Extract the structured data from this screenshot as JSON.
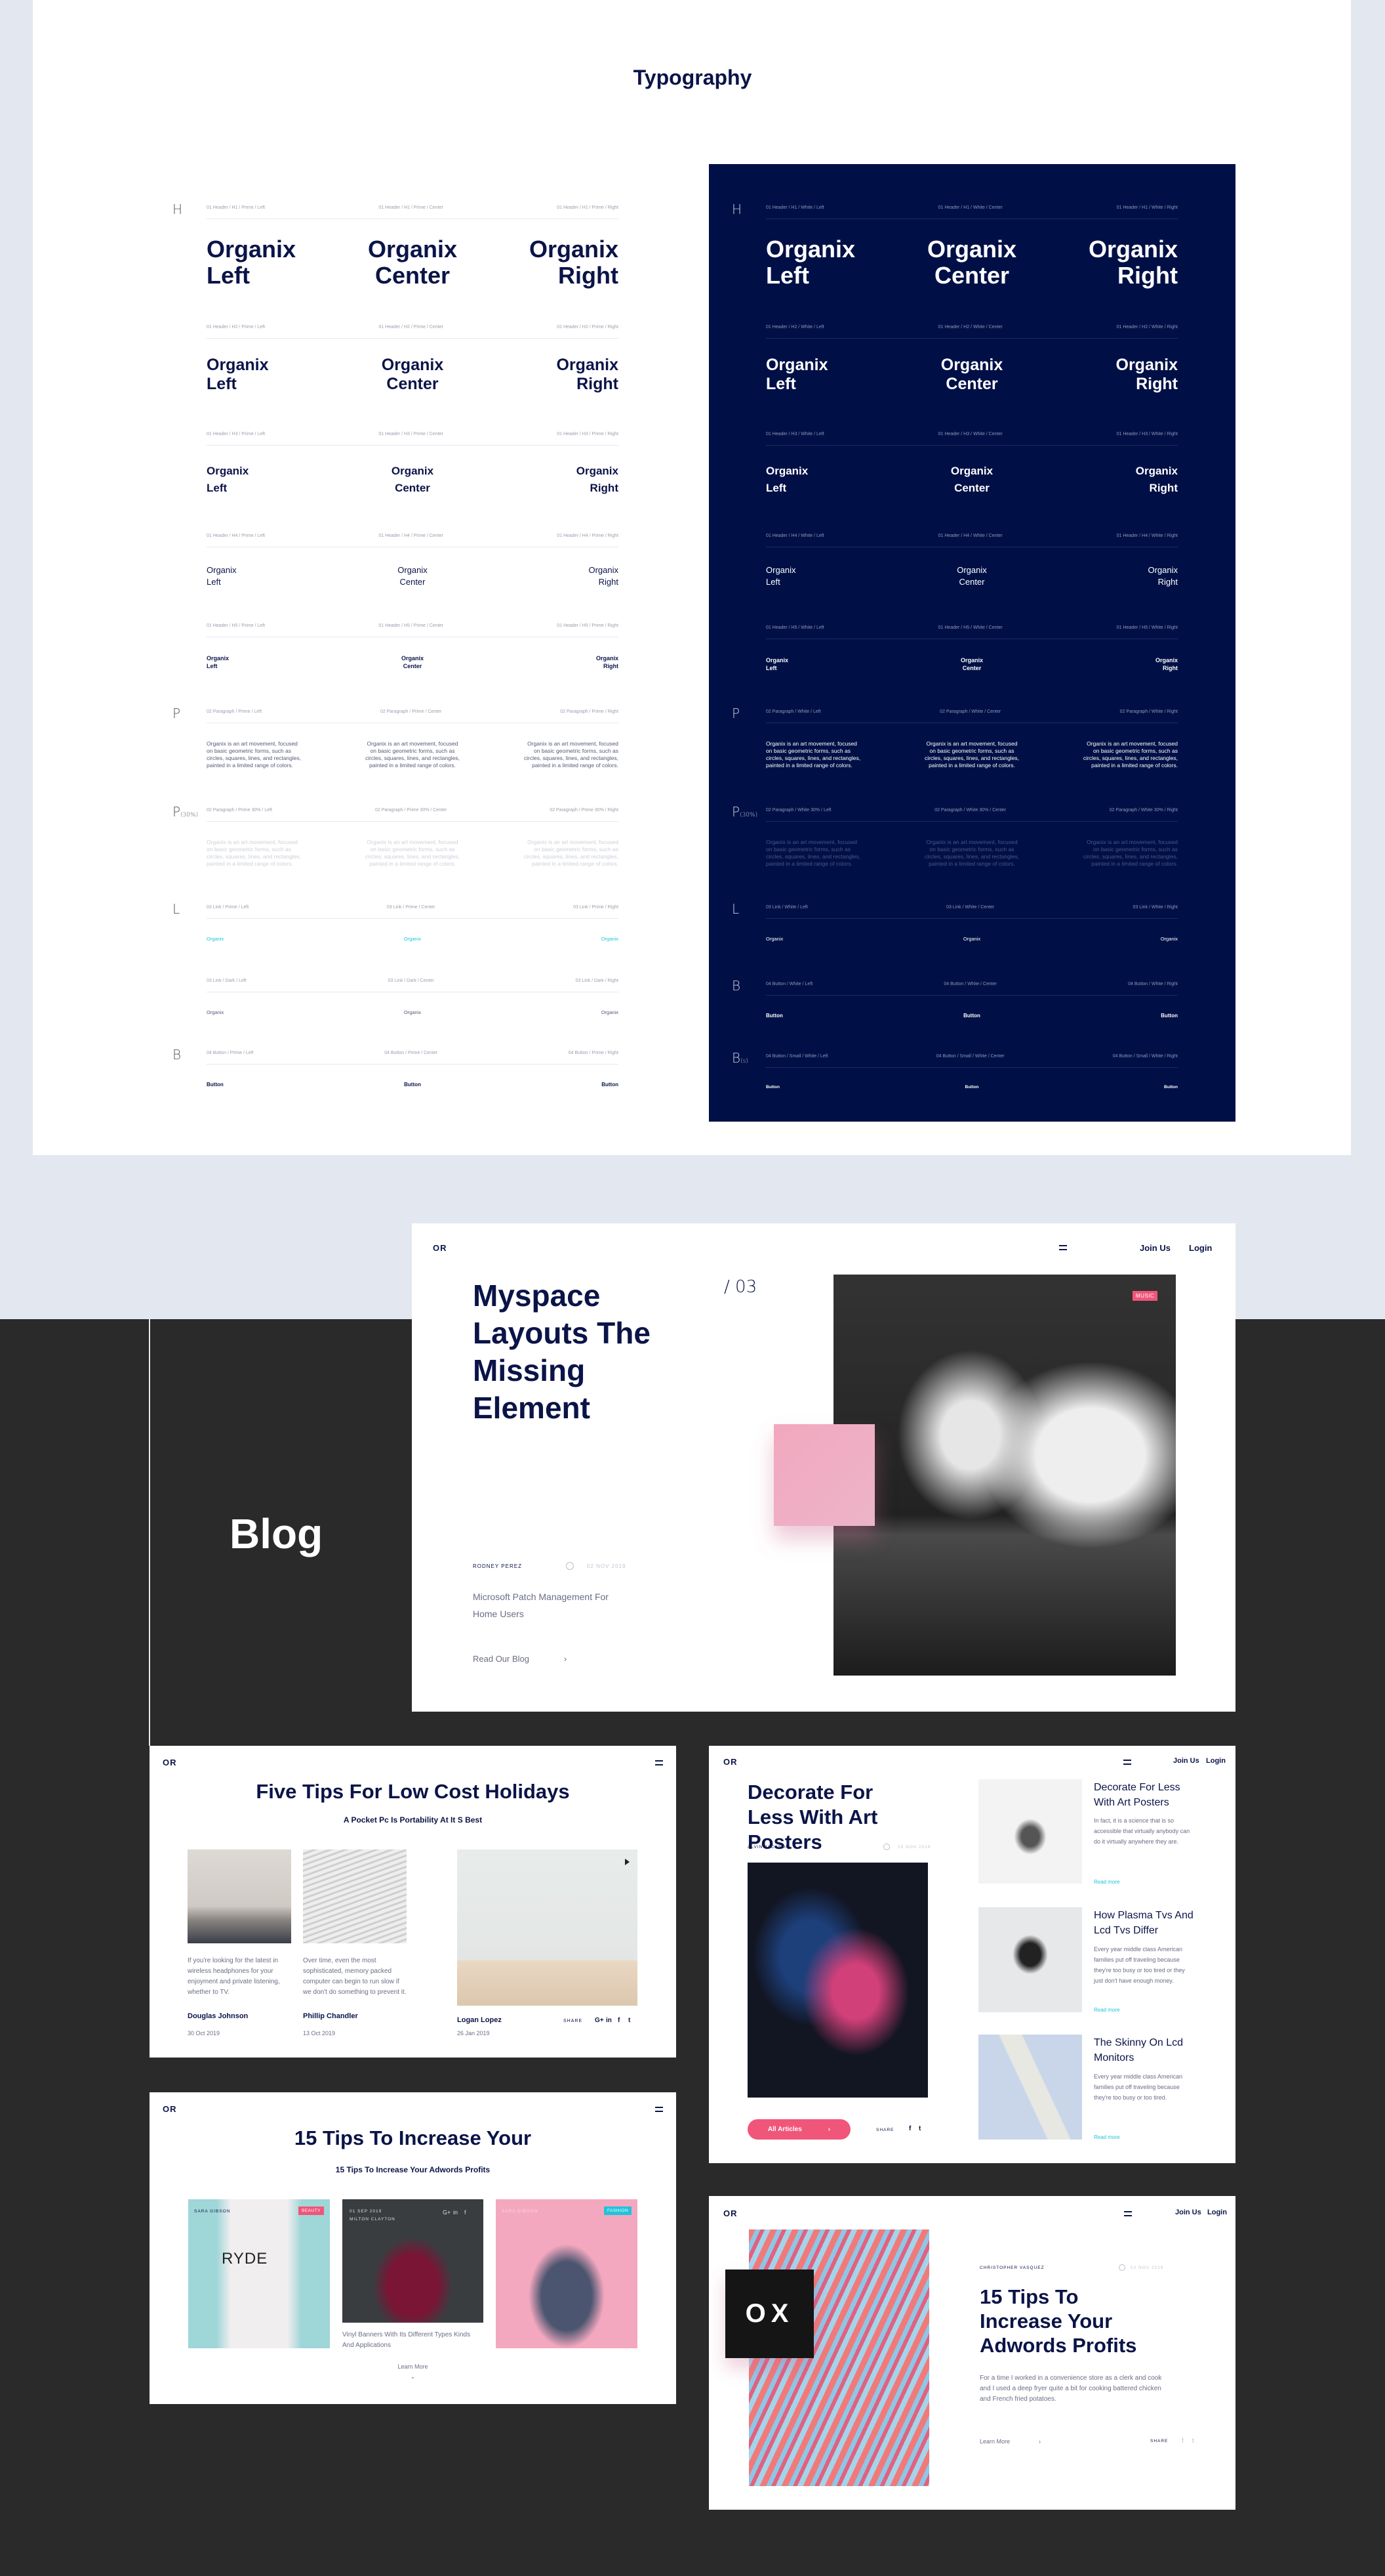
{
  "typography": {
    "title": "Typography",
    "light_rows": [
      {
        "letter": "H",
        "sub": "",
        "style": "h1",
        "labels": [
          "01 Header / H1 / Prime / Left",
          "01 Header / H1 / Prime / Center",
          "01 Header / H1 / Prime / Right"
        ],
        "samples": [
          "Organix\nLeft",
          "Organix\nCenter",
          "Organix\nRight"
        ]
      },
      {
        "letter": "",
        "sub": "",
        "style": "h2",
        "labels": [
          "01 Header / H2 / Prime / Left",
          "01 Header / H2 / Prime / Center",
          "01 Header / H2 / Prime / Right"
        ],
        "samples": [
          "Organix\nLeft",
          "Organix\nCenter",
          "Organix\nRight"
        ]
      },
      {
        "letter": "",
        "sub": "",
        "style": "h3",
        "labels": [
          "01 Header / H3 / Prime / Left",
          "01 Header / H3 / Prime / Center",
          "01 Header / H3 / Prime / Right"
        ],
        "samples": [
          "Organix\nLeft",
          "Organix\nCenter",
          "Organix\nRight"
        ]
      },
      {
        "letter": "",
        "sub": "",
        "style": "h4",
        "labels": [
          "01 Header / H4 / Prime / Left",
          "01 Header / H4 / Prime / Center",
          "01 Header / H4 / Prime / Right"
        ],
        "samples": [
          "Organix\nLeft",
          "Organix\nCenter",
          "Organix\nRight"
        ]
      },
      {
        "letter": "",
        "sub": "",
        "style": "h5",
        "labels": [
          "01 Header / H5 / Prime / Left",
          "01 Header / H5 / Prime / Center",
          "01 Header / H5 / Prime / Right"
        ],
        "samples": [
          "Organix\nLeft",
          "Organix\nCenter",
          "Organix\nRight"
        ]
      },
      {
        "letter": "P",
        "sub": "",
        "style": "p",
        "labels": [
          "02 Paragraph / Prime / Left",
          "02 Paragraph / Prime / Center",
          "02 Paragraph / Prime / Right"
        ],
        "samples": [
          "Organix is an art movement, focused\non basic geometric forms, such as\ncircles, squares, lines, and rectangles,\npainted in a limited range of colors.",
          "Organix is an art movement, focused\non basic geometric forms, such as\ncircles, squares, lines, and rectangles,\npainted in a limited range of colors.",
          "Organix is an art movement, focused\non basic geometric forms, such as\ncircles, squares, lines, and rectangles,\npainted in a limited range of colors."
        ]
      },
      {
        "letter": "P",
        "sub": "(30%)",
        "style": "p30",
        "labels": [
          "02 Paragraph / Prime 30% / Left",
          "02 Paragraph / Prime 30% / Center",
          "02 Paragraph / Prime 30% / Right"
        ],
        "samples": [
          "Organix is an art movement, focused\non basic geometric forms, such as\ncircles, squares, lines, and rectangles,\npainted in a limited range of colors.",
          "Organix is an art movement, focused\non basic geometric forms, such as\ncircles, squares, lines, and rectangles,\npainted in a limited range of colors.",
          "Organix is an art movement, focused\non basic geometric forms, such as\ncircles, squares, lines, and rectangles,\npainted in a limited range of colors."
        ]
      },
      {
        "letter": "L",
        "sub": "",
        "style": "link",
        "labels": [
          "03 Link / Prime / Left",
          "03 Link / Prime / Center",
          "03 Link / Prime / Right"
        ],
        "samples": [
          "Organix",
          "Organix",
          "Organix"
        ]
      },
      {
        "letter": "",
        "sub": "",
        "style": "linkdark",
        "labels": [
          "03 Link / Dark / Left",
          "03 Link / Dark / Center",
          "03 Link / Dark / Right"
        ],
        "samples": [
          "Organix",
          "Organix",
          "Organix"
        ]
      },
      {
        "letter": "B",
        "sub": "",
        "style": "btn",
        "labels": [
          "04 Button / Prime / Left",
          "04 Button / Prime / Center",
          "04 Button / Prime / Right"
        ],
        "samples": [
          "Button",
          "Button",
          "Button"
        ]
      }
    ],
    "dark_rows": [
      {
        "letter": "H",
        "sub": "",
        "style": "h1",
        "labels": [
          "01 Header / H1 / White / Left",
          "01 Header / H1 / White / Center",
          "01 Header / H1 / White / Right"
        ],
        "samples": [
          "Organix\nLeft",
          "Organix\nCenter",
          "Organix\nRight"
        ]
      },
      {
        "letter": "",
        "sub": "",
        "style": "h2",
        "labels": [
          "01 Header / H2 / White / Left",
          "01 Header / H2 / White / Center",
          "01 Header / H2 / White / Right"
        ],
        "samples": [
          "Organix\nLeft",
          "Organix\nCenter",
          "Organix\nRight"
        ]
      },
      {
        "letter": "",
        "sub": "",
        "style": "h3",
        "labels": [
          "01 Header / H3 / White / Left",
          "01 Header / H3 / White / Center",
          "01 Header / H3 / White / Right"
        ],
        "samples": [
          "Organix\nLeft",
          "Organix\nCenter",
          "Organix\nRight"
        ]
      },
      {
        "letter": "",
        "sub": "",
        "style": "h4",
        "labels": [
          "01 Header / H4 / White / Left",
          "01 Header / H4 / White / Center",
          "01 Header / H4 / White / Right"
        ],
        "samples": [
          "Organix\nLeft",
          "Organix\nCenter",
          "Organix\nRight"
        ]
      },
      {
        "letter": "",
        "sub": "",
        "style": "h5",
        "labels": [
          "01 Header / H5 / White / Left",
          "01 Header / H5 / White / Center",
          "01 Header / H5 / White / Right"
        ],
        "samples": [
          "Organix\nLeft",
          "Organix\nCenter",
          "Organix\nRight"
        ]
      },
      {
        "letter": "P",
        "sub": "",
        "style": "p",
        "labels": [
          "02 Paragraph / White / Left",
          "02 Paragraph / White / Center",
          "02 Paragraph / White / Right"
        ],
        "samples": [
          "Organix is an art movement, focused\non basic geometric forms, such as\ncircles, squares, lines, and rectangles,\npainted in a limited range of colors.",
          "Organix is an art movement, focused\non basic geometric forms, such as\ncircles, squares, lines, and rectangles,\npainted in a limited range of colors.",
          "Organix is an art movement, focused\non basic geometric forms, such as\ncircles, squares, lines, and rectangles,\npainted in a limited range of colors."
        ]
      },
      {
        "letter": "P",
        "sub": "(30%)",
        "style": "p30",
        "labels": [
          "02 Paragraph / White 30% / Left",
          "02 Paragraph / White 30% / Center",
          "02 Paragraph / White 30% / Right"
        ],
        "samples": [
          "Organix is an art movement, focused\non basic geometric forms, such as\ncircles, squares, lines, and rectangles,\npainted in a limited range of colors.",
          "Organix is an art movement, focused\non basic geometric forms, such as\ncircles, squares, lines, and rectangles,\npainted in a limited range of colors.",
          "Organix is an art movement, focused\non basic geometric forms, such as\ncircles, squares, lines, and rectangles,\npainted in a limited range of colors."
        ]
      },
      {
        "letter": "L",
        "sub": "",
        "style": "link",
        "labels": [
          "03 Link / White / Left",
          "03 Link / White / Center",
          "03 Link / White / Right"
        ],
        "samples": [
          "Organix",
          "Organix",
          "Organix"
        ]
      },
      {
        "letter": "B",
        "sub": "",
        "style": "btn",
        "labels": [
          "04 Button / White / Left",
          "04 Button / White / Center",
          "04 Button / White / Right"
        ],
        "samples": [
          "Button",
          "Button",
          "Button"
        ]
      },
      {
        "letter": "B",
        "sub": "(s)",
        "style": "btns",
        "labels": [
          "04 Button / Small / White / Left",
          "04 Button / Small / White / Center",
          "04 Button / Small / White / Right"
        ],
        "samples": [
          "Button",
          "Button",
          "Button"
        ]
      }
    ]
  },
  "blog_label": "Blog",
  "brand": {
    "logo": "OR",
    "join": "Join Us",
    "login": "Login"
  },
  "hero": {
    "title": "Myspace Layouts The Missing Element",
    "counter": "/ 03",
    "badge": "MUSIC",
    "author": "RODNEY PEREZ",
    "date": "02 NOV 2019",
    "excerpt": "Microsoft Patch Management For Home Users",
    "cta": "Read Our Blog"
  },
  "card1": {
    "title": "Five Tips For Low Cost Holidays",
    "subtitle": "A Pocket Pc Is Portability At It S Best",
    "posts": [
      {
        "text": "If you're looking for the latest in wireless headphones for your enjoyment and private listening, whether to TV.",
        "author": "Douglas Johnson",
        "date": "30 Oct 2019"
      },
      {
        "text": "Over time, even the most sophisticated, memory packed computer can begin to run slow if we don't do something to prevent it.",
        "author": "Phillip Chandler",
        "date": "13 Oct 2019"
      },
      {
        "author": "Logan Lopez",
        "date": "26 Jan 2019"
      }
    ],
    "share": "SHARE"
  },
  "card2": {
    "title": "15 Tips To Increase Your",
    "subtitle": "15 Tips To Increase Your Adwords Profits",
    "items": [
      {
        "author": "SARA GIBSON",
        "badge": "BEAUTY",
        "shirt": "RYDE"
      },
      {
        "date": "01 SEP 2019",
        "author": "MILTON CLAYTON",
        "caption": "Vinyl Banners With Its Different Types Kinds And Applications"
      },
      {
        "author": "SARA GIBSON",
        "badge": "FASHION"
      }
    ],
    "more": "Learn More"
  },
  "card3": {
    "title": "Decorate For Less With Art Posters",
    "author": "ALVIN JACKSON",
    "date": "15 NOV 2019",
    "button": "All Articles",
    "share": "SHARE",
    "items": [
      {
        "title": "Decorate For Less With Art Posters",
        "text": "In fact, it is a science that is so accessible that virtually anybody can do it virtually anywhere they are.",
        "link": "Read more"
      },
      {
        "title": "How Plasma Tvs And Lcd Tvs Differ",
        "text": "Every year middle class American families put off traveling because they're too busy or too tired or they just don't have enough money.",
        "link": "Read more"
      },
      {
        "title": "The Skinny On Lcd Monitors",
        "text": "Every year middle class American families put off traveling because they're too busy or too tired.",
        "link": "Read more"
      }
    ]
  },
  "card4": {
    "overlay": "OX",
    "author": "CHRISTOPHER VASQUEZ",
    "date": "02 NOV 2019",
    "title": "15 Tips To Increase Your Adwords Profits",
    "text": "For a time I worked in a convenience store as a clerk and cook and I used a deep fryer quite a bit for cooking battered chicken and French fried potatoes.",
    "more": "Learn More",
    "share": "SHARE"
  },
  "colors": {
    "navy": "#0b1448",
    "panel": "#001046",
    "accent_pink": "#f0567a",
    "link_cyan": "#1fc4dc"
  }
}
